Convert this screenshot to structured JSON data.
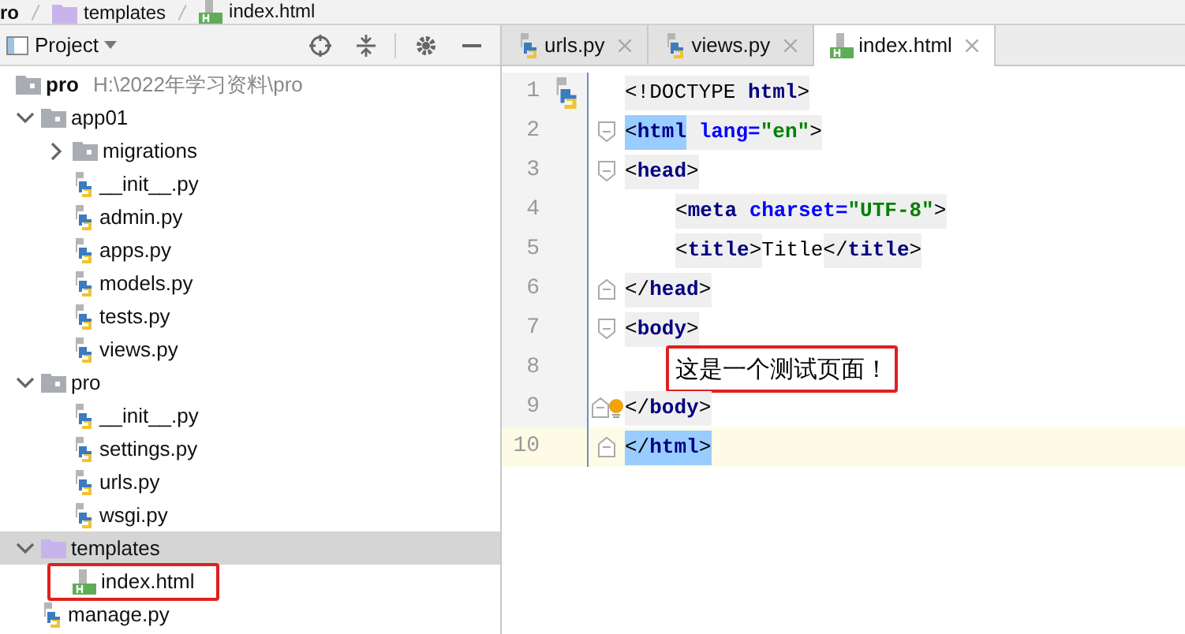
{
  "breadcrumb": [
    {
      "label": "ro"
    },
    {
      "kind": "template_folder",
      "label": "templates"
    },
    {
      "kind": "html",
      "label": "index.html"
    }
  ],
  "project_panel": {
    "title": "Project"
  },
  "tree": {
    "label": "pro",
    "hint": "H:\\2022年学习资料\\pro",
    "kind": "folder",
    "selected": false,
    "boxed": false,
    "children": [
      {
        "label": "app01",
        "kind": "folder",
        "expanded": true,
        "selected": false,
        "boxed": false,
        "children": [
          {
            "label": "migrations",
            "kind": "folder",
            "expanded": false,
            "selected": false,
            "boxed": false
          },
          {
            "label": "__init__.py",
            "kind": "python",
            "selected": false,
            "boxed": false
          },
          {
            "label": "admin.py",
            "kind": "python",
            "selected": false,
            "boxed": false
          },
          {
            "label": "apps.py",
            "kind": "python",
            "selected": false,
            "boxed": false
          },
          {
            "label": "models.py",
            "kind": "python",
            "selected": false,
            "boxed": false
          },
          {
            "label": "tests.py",
            "kind": "python",
            "selected": false,
            "boxed": false
          },
          {
            "label": "views.py",
            "kind": "python",
            "selected": false,
            "boxed": false
          }
        ]
      },
      {
        "label": "pro",
        "kind": "folder",
        "expanded": true,
        "selected": false,
        "boxed": false,
        "children": [
          {
            "label": "__init__.py",
            "kind": "python",
            "selected": false,
            "boxed": false
          },
          {
            "label": "settings.py",
            "kind": "python",
            "selected": false,
            "boxed": false
          },
          {
            "label": "urls.py",
            "kind": "python",
            "selected": false,
            "boxed": false
          },
          {
            "label": "wsgi.py",
            "kind": "python",
            "selected": false,
            "boxed": false
          }
        ]
      },
      {
        "label": "templates",
        "kind": "template_folder",
        "expanded": true,
        "selected": true,
        "boxed": false,
        "children": [
          {
            "label": "index.html",
            "kind": "html",
            "selected": false,
            "boxed": true
          }
        ]
      },
      {
        "label": "manage.py",
        "kind": "python",
        "selected": false,
        "boxed": false
      }
    ]
  },
  "tabs": [
    {
      "label": "urls.py",
      "kind": "python",
      "selected": false
    },
    {
      "label": "views.py",
      "kind": "python",
      "selected": false
    },
    {
      "label": "index.html",
      "kind": "html",
      "selected": true
    }
  ],
  "editor": {
    "lines": [
      {
        "number": "1",
        "fold_start": false,
        "fold_end": false,
        "current": false,
        "boxed": false,
        "indented": false,
        "tokens": [
          {
            "text": "<!DOCTYPE",
            "kind": "punct",
            "highlighted": true,
            "matched": false
          },
          {
            "text": " html",
            "kind": "tag",
            "highlighted": true,
            "matched": false
          },
          {
            "text": ">",
            "kind": "punct",
            "highlighted": true,
            "matched": false
          }
        ]
      },
      {
        "number": "2",
        "fold_start": true,
        "fold_end": false,
        "current": false,
        "boxed": false,
        "indented": false,
        "tokens": [
          {
            "text": "<",
            "kind": "punct",
            "matched": true
          },
          {
            "text": "html",
            "kind": "tag",
            "matched": true
          },
          {
            "text": " lang=",
            "kind": "attr",
            "highlighted": true,
            "matched": false
          },
          {
            "text": "\"en\"",
            "kind": "string",
            "highlighted": true,
            "matched": false
          },
          {
            "text": ">",
            "kind": "punct",
            "highlighted": true,
            "matched": false
          }
        ]
      },
      {
        "number": "3",
        "fold_start": true,
        "fold_end": false,
        "current": false,
        "boxed": false,
        "indented": false,
        "tokens": [
          {
            "text": "<",
            "kind": "punct",
            "highlighted": true,
            "matched": false
          },
          {
            "text": "head",
            "kind": "tag",
            "highlighted": true,
            "matched": false
          },
          {
            "text": ">",
            "kind": "punct",
            "highlighted": true,
            "matched": false
          }
        ]
      },
      {
        "number": "4",
        "fold_start": false,
        "fold_end": false,
        "current": false,
        "boxed": false,
        "indented": true,
        "tokens": [
          {
            "text": "<",
            "kind": "punct",
            "highlighted": true,
            "matched": false
          },
          {
            "text": "meta",
            "kind": "tag",
            "highlighted": true,
            "matched": false
          },
          {
            "text": " charset=",
            "kind": "attr",
            "highlighted": true,
            "matched": false
          },
          {
            "text": "\"UTF-8\"",
            "kind": "string",
            "highlighted": true,
            "matched": false
          },
          {
            "text": ">",
            "kind": "punct",
            "highlighted": true,
            "matched": false
          }
        ]
      },
      {
        "number": "5",
        "fold_start": false,
        "fold_end": false,
        "current": false,
        "boxed": false,
        "indented": true,
        "tokens": [
          {
            "text": "<",
            "kind": "punct",
            "highlighted": true,
            "matched": false
          },
          {
            "text": "title",
            "kind": "tag",
            "highlighted": true,
            "matched": false
          },
          {
            "text": ">",
            "kind": "punct",
            "highlighted": true,
            "matched": false
          },
          {
            "text": "Title",
            "kind": "text",
            "highlighted": false,
            "matched": false
          },
          {
            "text": "</",
            "kind": "punct",
            "highlighted": true,
            "matched": false
          },
          {
            "text": "title",
            "kind": "tag",
            "highlighted": true,
            "matched": false
          },
          {
            "text": ">",
            "kind": "punct",
            "highlighted": true,
            "matched": false
          }
        ]
      },
      {
        "number": "6",
        "fold_start": false,
        "fold_end": true,
        "current": false,
        "boxed": false,
        "indented": false,
        "tokens": [
          {
            "text": "</",
            "kind": "punct",
            "highlighted": true,
            "matched": false
          },
          {
            "text": "head",
            "kind": "tag",
            "highlighted": true,
            "matched": false
          },
          {
            "text": ">",
            "kind": "punct",
            "highlighted": true,
            "matched": false
          }
        ]
      },
      {
        "number": "7",
        "fold_start": true,
        "fold_end": false,
        "current": false,
        "boxed": false,
        "indented": false,
        "tokens": [
          {
            "text": "<",
            "kind": "punct",
            "highlighted": true,
            "matched": false
          },
          {
            "text": "body",
            "kind": "tag",
            "highlighted": true,
            "matched": false
          },
          {
            "text": ">",
            "kind": "punct",
            "highlighted": true,
            "matched": false
          }
        ]
      },
      {
        "number": "8",
        "fold_start": false,
        "fold_end": false,
        "current": false,
        "boxed": true,
        "indented": true,
        "tokens": [
          {
            "text": "这是一个测试页面！",
            "kind": "text",
            "highlighted": false,
            "matched": false
          }
        ]
      },
      {
        "number": "9",
        "fold_start": false,
        "fold_end": true,
        "current": false,
        "boxed": false,
        "indented": false,
        "bulb": true,
        "tokens": [
          {
            "text": "</",
            "kind": "punct",
            "highlighted": true,
            "matched": false
          },
          {
            "text": "body",
            "kind": "tag",
            "highlighted": true,
            "matched": false
          },
          {
            "text": ">",
            "kind": "punct",
            "highlighted": true,
            "matched": false
          }
        ]
      },
      {
        "number": "10",
        "fold_start": false,
        "fold_end": true,
        "current": true,
        "boxed": false,
        "indented": false,
        "tokens": [
          {
            "text": "</",
            "kind": "punct",
            "matched": true
          },
          {
            "text": "html",
            "kind": "tag",
            "matched": true
          },
          {
            "text": ">",
            "kind": "punct",
            "matched": true
          }
        ]
      }
    ]
  }
}
